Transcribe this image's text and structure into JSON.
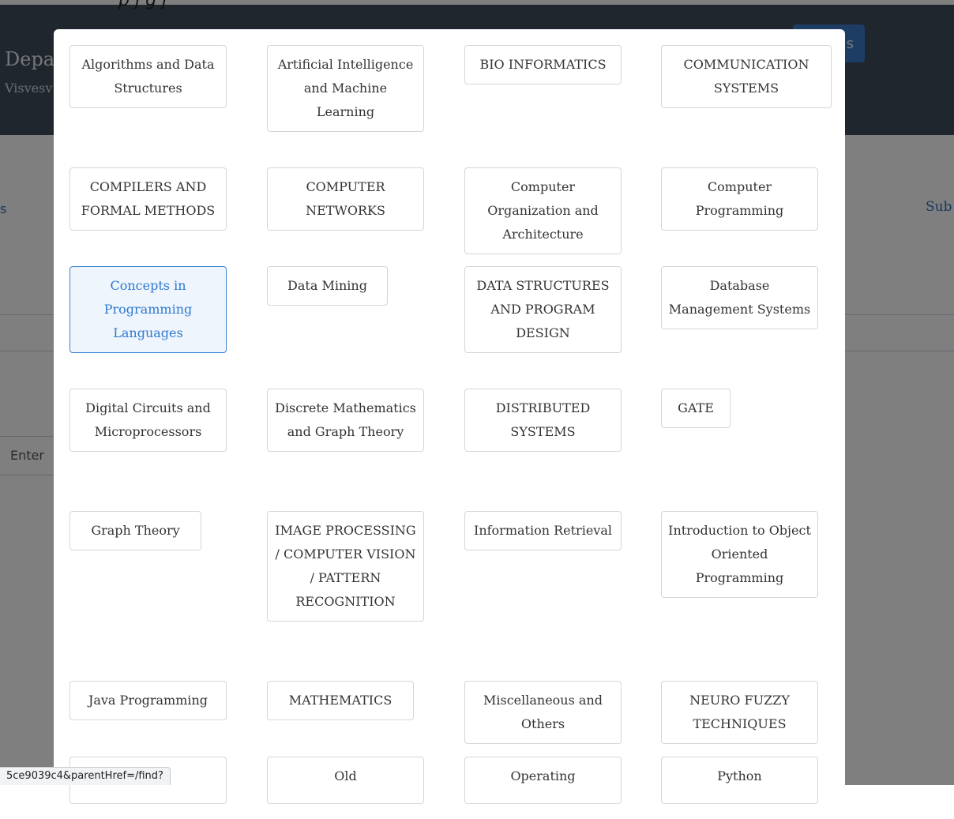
{
  "header": {
    "top_text": "p                  j  g      j",
    "title": "Depa",
    "subtitle": "Visvesv",
    "button_label": "s"
  },
  "background": {
    "left_link": "s",
    "right_link": "Sub",
    "input_placeholder": "Enter"
  },
  "status_bar": {
    "url": "5ce9039c4&parentHref=/find?"
  },
  "modal": {
    "tags": [
      {
        "label": "Algorithms and Data Structures",
        "active": false
      },
      {
        "label": "Artificial Intelligence and Machine Learning",
        "active": false
      },
      {
        "label": "BIO INFORMATICS",
        "active": false
      },
      {
        "label": "COMMUNICATION SYSTEMS",
        "active": false
      },
      {
        "label": "COMPILERS AND FORMAL METHODS",
        "active": false
      },
      {
        "label": "COMPUTER NETWORKS",
        "active": false
      },
      {
        "label": "Computer Organization and Architecture",
        "active": false
      },
      {
        "label": "Computer Programming",
        "active": false
      },
      {
        "label": "Concepts in Programming Languages",
        "active": true
      },
      {
        "label": "Data Mining",
        "active": false
      },
      {
        "label": "DATA STRUCTURES AND PROGRAM DESIGN",
        "active": false
      },
      {
        "label": "Database Management Systems",
        "active": false
      },
      {
        "label": "Digital Circuits and Microprocessors",
        "active": false
      },
      {
        "label": "Discrete Mathematics and Graph Theory",
        "active": false
      },
      {
        "label": "DISTRIBUTED SYSTEMS",
        "active": false
      },
      {
        "label": "GATE",
        "active": false
      },
      {
        "label": "Graph Theory",
        "active": false
      },
      {
        "label": "IMAGE PROCESSING / COMPUTER VISION / PATTERN RECOGNITION",
        "active": false
      },
      {
        "label": "Information Retrieval",
        "active": false
      },
      {
        "label": "Introduction to Object Oriented Programming",
        "active": false
      },
      {
        "label": "Java Programming",
        "active": false
      },
      {
        "label": "MATHEMATICS",
        "active": false
      },
      {
        "label": "Miscellaneous and Others",
        "active": false
      },
      {
        "label": "NEURO FUZZY TECHNIQUES",
        "active": false
      },
      {
        "label": "",
        "active": false
      },
      {
        "label": "Old",
        "active": false
      },
      {
        "label": "Operating",
        "active": false
      },
      {
        "label": "Python",
        "active": false
      }
    ]
  }
}
